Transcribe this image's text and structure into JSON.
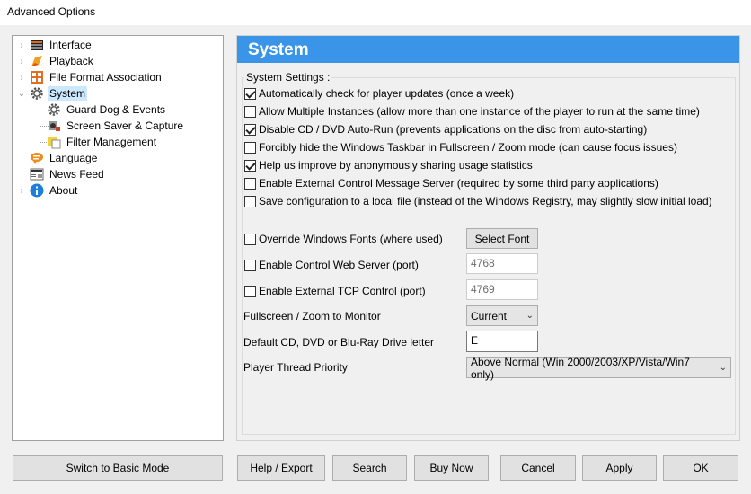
{
  "window": {
    "title": "Advanced Options"
  },
  "tree": {
    "items": [
      {
        "label": "Interface",
        "icon": "interface-icon",
        "expander": "›"
      },
      {
        "label": "Playback",
        "icon": "playback-icon",
        "expander": "›"
      },
      {
        "label": "File Format Association",
        "icon": "file-format-icon",
        "expander": "›"
      },
      {
        "label": "System",
        "icon": "gear-icon",
        "expander": "⌄"
      },
      {
        "label": "Guard Dog & Events",
        "icon": "gear-icon"
      },
      {
        "label": "Screen Saver & Capture",
        "icon": "screensaver-icon"
      },
      {
        "label": "Filter Management",
        "icon": "filter-icon"
      },
      {
        "label": "Language",
        "icon": "language-icon"
      },
      {
        "label": "News Feed",
        "icon": "news-icon"
      },
      {
        "label": "About",
        "icon": "info-icon",
        "expander": "›"
      }
    ]
  },
  "panel": {
    "header": "System",
    "group_label": "System Settings :",
    "checkboxes": [
      {
        "label": "Automatically check for player updates (once a week)",
        "checked": true
      },
      {
        "label": "Allow Multiple Instances (allow more than one instance of the player to run at the same time)",
        "checked": false
      },
      {
        "label": "Disable CD / DVD Auto-Run (prevents applications on the disc from auto-starting)",
        "checked": true
      },
      {
        "label": "Forcibly hide the Windows Taskbar in Fullscreen / Zoom mode (can cause focus issues)",
        "checked": false
      },
      {
        "label": "Help us improve by anonymously sharing usage statistics",
        "checked": true
      },
      {
        "label": "Enable External Control Message Server (required by some third party applications)",
        "checked": false
      },
      {
        "label": "Save configuration to a local file (instead of the Windows Registry, may slightly slow initial load)",
        "checked": false
      }
    ],
    "override_fonts": {
      "label": "Override Windows Fonts (where used)",
      "checked": false,
      "button": "Select Font"
    },
    "web_server": {
      "label": "Enable Control Web Server (port)",
      "checked": false,
      "value": "4768"
    },
    "tcp_control": {
      "label": "Enable External TCP Control (port)",
      "checked": false,
      "value": "4769"
    },
    "fullscreen_monitor": {
      "label": "Fullscreen / Zoom to Monitor",
      "value": "Current"
    },
    "drive_letter": {
      "label": "Default CD, DVD or Blu-Ray Drive letter",
      "value": "E"
    },
    "thread_priority": {
      "label": "Player Thread Priority",
      "value": "Above Normal (Win 2000/2003/XP/Vista/Win7 only)"
    }
  },
  "buttons": {
    "basic_mode": "Switch to Basic Mode",
    "help_export": "Help / Export",
    "search": "Search",
    "buy_now": "Buy Now",
    "cancel": "Cancel",
    "apply": "Apply",
    "ok": "OK"
  }
}
